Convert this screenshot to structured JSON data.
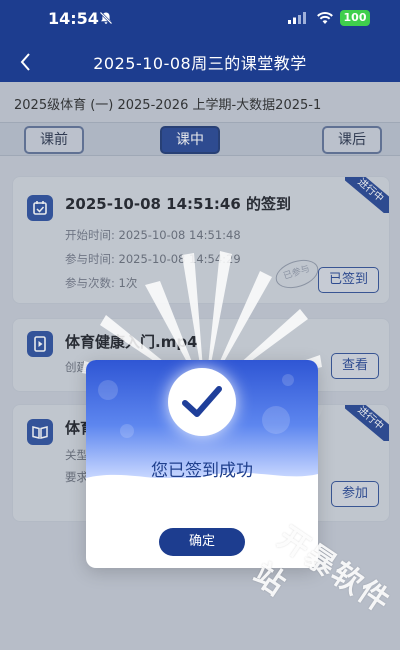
{
  "status_bar": {
    "time": "14:54",
    "battery": "100",
    "icons": [
      "bell-mute-icon",
      "signal-icon",
      "wifi-icon",
      "battery-icon"
    ]
  },
  "header": {
    "title": "2025-10-08周三的课堂教学",
    "back_icon": "chevron-left-icon"
  },
  "course_line": "2025级体育 (一) 2025-2026 上学期-大数据2025-1",
  "tabs": [
    {
      "label": "课前",
      "active": false
    },
    {
      "label": "课中",
      "active": true
    },
    {
      "label": "课后",
      "active": false
    }
  ],
  "cards": [
    {
      "title": "2025-10-08 14:51:46 的签到",
      "ribbon": "进行中",
      "meta": [
        {
          "key": "开始时间:",
          "value": "2025-10-08 14:51:48"
        },
        {
          "key": "参与时间:",
          "value": "2025-10-08 14:54:29"
        },
        {
          "key": "参与次数:",
          "value": "1次"
        }
      ],
      "stamp": "已参与",
      "button": "已签到"
    },
    {
      "title": "体育健康入门.mp4",
      "meta_prefix": "创建",
      "button": "查看"
    },
    {
      "title": "体育",
      "ribbon": "进行中",
      "meta_prefix1": "关型",
      "meta_prefix2": "要求",
      "button": "参加"
    }
  ],
  "modal": {
    "message": "您已签到成功",
    "confirm": "确定",
    "colors": {
      "accent": "#1d3d8f",
      "gradient_top": "#2f56d4",
      "gradient_mid": "#5d86ef"
    }
  },
  "watermark": "开暴软件站"
}
